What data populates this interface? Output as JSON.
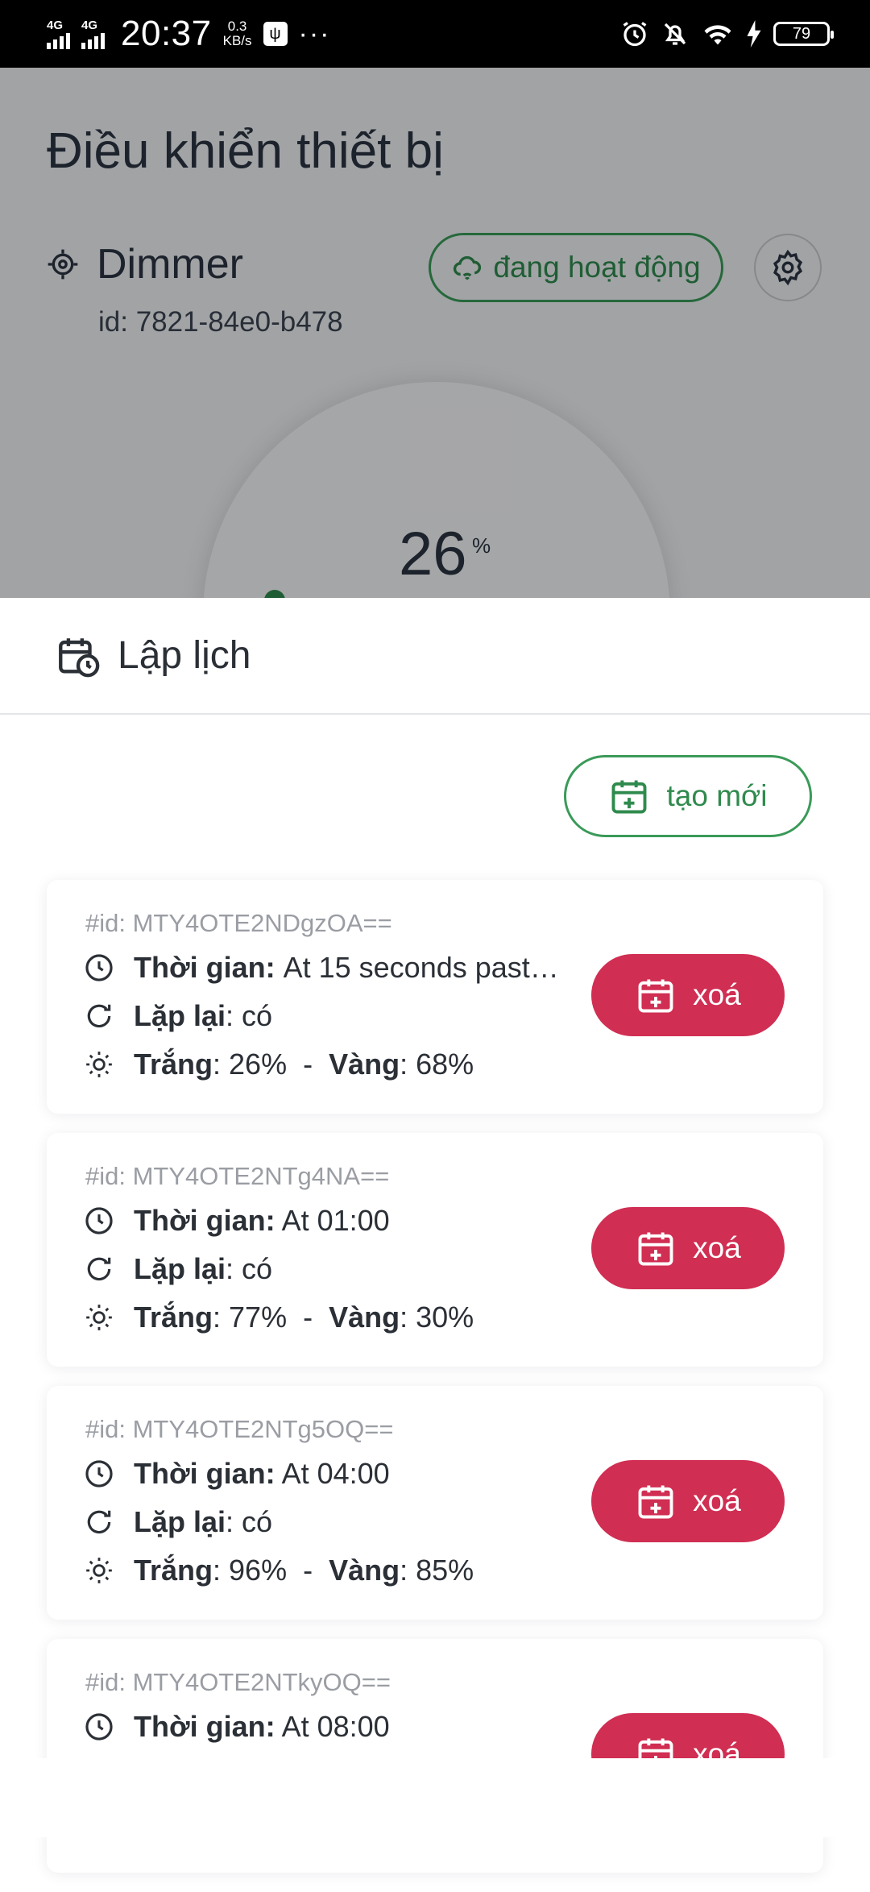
{
  "status_bar": {
    "net1": "4G",
    "net2": "4G",
    "time": "20:37",
    "speed_value": "0.3",
    "speed_unit": "KB/s",
    "more": "···",
    "battery": "79"
  },
  "header": {
    "title": "Điều khiển thiết bị",
    "device_name": "Dimmer",
    "device_id": "id: 7821-84e0-b478",
    "status": "đang hoạt động",
    "dial_value": "26",
    "dial_unit": "%"
  },
  "sheet": {
    "title": "Lập lịch",
    "create_label": "tạo mới",
    "labels": {
      "time": "Thời gian:",
      "repeat": "Lặp lại",
      "white": "Trắng",
      "yellow": "Vàng",
      "delete": "xoá"
    },
    "items": [
      {
        "id": "#id: MTY4OTE2NDgzOA==",
        "time": "At 15 seconds past…",
        "repeat": ": có",
        "white": ": 26%",
        "yellow": ": 68%"
      },
      {
        "id": "#id: MTY4OTE2NTg4NA==",
        "time": "At 01:00",
        "repeat": ": có",
        "white": ": 77%",
        "yellow": ": 30%"
      },
      {
        "id": "#id: MTY4OTE2NTg5OQ==",
        "time": "At 04:00",
        "repeat": ": có",
        "white": ": 96%",
        "yellow": ": 85%"
      },
      {
        "id": "#id: MTY4OTE2NTkyOQ==",
        "time": "At 08:00"
      }
    ]
  },
  "colors": {
    "accent_green": "#2f8a4d",
    "delete_red": "#d02e52"
  }
}
